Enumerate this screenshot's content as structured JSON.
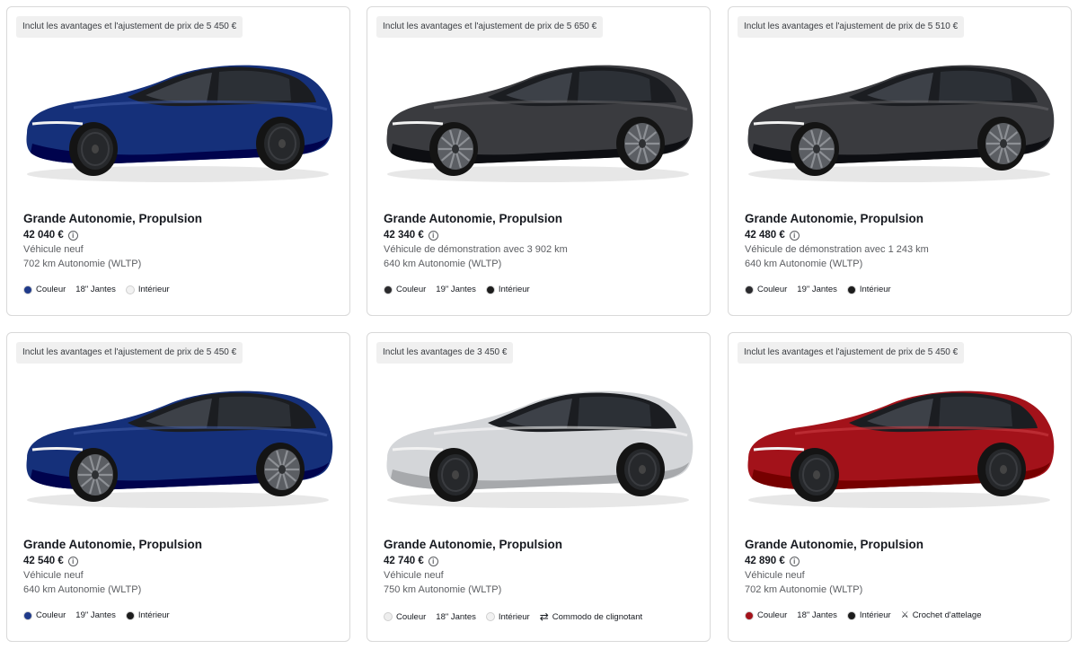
{
  "cards": [
    {
      "badge": "Inclut les avantages et l'ajustement de prix de 5 450 €",
      "title": "Grande Autonomie, Propulsion",
      "price": "42 040 €",
      "condition": "Véhicule neuf",
      "range": "702 km Autonomie (WLTP)",
      "paint": "#15307a",
      "wheels": "aero",
      "features": [
        {
          "icon": "color-dot",
          "color": "#1f3a8a",
          "label": "Couleur"
        },
        {
          "icon": "wheel-size",
          "label": "18\" Jantes"
        },
        {
          "icon": "color-dot",
          "color": "#f2f2f2",
          "label": "Intérieur"
        }
      ]
    },
    {
      "badge": "Inclut les avantages et l'ajustement de prix de 5 650 €",
      "title": "Grande Autonomie, Propulsion",
      "price": "42 340 €",
      "condition": "Véhicule de démonstration avec 3 902 km",
      "range": "640 km Autonomie (WLTP)",
      "paint": "#3a3b3f",
      "wheels": "spoke",
      "features": [
        {
          "icon": "color-dot",
          "color": "#2a2a2d",
          "label": "Couleur"
        },
        {
          "icon": "wheel-size",
          "label": "19\" Jantes"
        },
        {
          "icon": "color-dot",
          "color": "#1c1c1c",
          "label": "Intérieur"
        }
      ]
    },
    {
      "badge": "Inclut les avantages et l'ajustement de prix de 5 510 €",
      "title": "Grande Autonomie, Propulsion",
      "price": "42 480 €",
      "condition": "Véhicule de démonstration avec 1 243 km",
      "range": "640 km Autonomie (WLTP)",
      "paint": "#3a3b3f",
      "wheels": "spoke",
      "features": [
        {
          "icon": "color-dot",
          "color": "#2a2a2d",
          "label": "Couleur"
        },
        {
          "icon": "wheel-size",
          "label": "19\" Jantes"
        },
        {
          "icon": "color-dot",
          "color": "#1c1c1c",
          "label": "Intérieur"
        }
      ]
    },
    {
      "badge": "Inclut les avantages et l'ajustement de prix de 5 450 €",
      "title": "Grande Autonomie, Propulsion",
      "price": "42 540 €",
      "condition": "Véhicule neuf",
      "range": "640 km Autonomie (WLTP)",
      "paint": "#15307a",
      "wheels": "spoke",
      "features": [
        {
          "icon": "color-dot",
          "color": "#1f3a8a",
          "label": "Couleur"
        },
        {
          "icon": "wheel-size",
          "label": "19\" Jantes"
        },
        {
          "icon": "color-dot",
          "color": "#1c1c1c",
          "label": "Intérieur"
        }
      ]
    },
    {
      "badge": "Inclut les avantages de 3 450 €",
      "title": "Grande Autonomie, Propulsion",
      "price": "42 740 €",
      "condition": "Véhicule neuf",
      "range": "750 km Autonomie (WLTP)",
      "paint": "#d4d6d9",
      "wheels": "aero",
      "features": [
        {
          "icon": "color-dot",
          "color": "#eeeeee",
          "label": "Couleur"
        },
        {
          "icon": "wheel-size",
          "label": "18\" Jantes"
        },
        {
          "icon": "color-dot",
          "color": "#f2f2f2",
          "label": "Intérieur"
        },
        {
          "icon": "turn-signal-icon",
          "label": "Commodo de clignotant"
        }
      ]
    },
    {
      "badge": "Inclut les avantages et l'ajustement de prix de 5 450 €",
      "title": "Grande Autonomie, Propulsion",
      "price": "42 890 €",
      "condition": "Véhicule neuf",
      "range": "702 km Autonomie (WLTP)",
      "paint": "#a3121a",
      "wheels": "aero",
      "features": [
        {
          "icon": "color-dot",
          "color": "#a3121a",
          "label": "Couleur"
        },
        {
          "icon": "wheel-size",
          "label": "18\" Jantes"
        },
        {
          "icon": "color-dot",
          "color": "#1c1c1c",
          "label": "Intérieur"
        },
        {
          "icon": "tow-hitch-icon",
          "label": "Crochet d'attelage"
        }
      ]
    }
  ]
}
